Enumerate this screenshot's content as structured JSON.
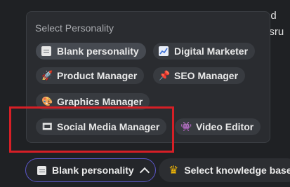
{
  "background_text": {
    "line1": "red",
    "line2": "isru"
  },
  "popup": {
    "title": "Select Personality",
    "options": [
      {
        "label": "Blank personality",
        "icon": "document-icon",
        "selected": true
      },
      {
        "label": "Digital Marketer",
        "icon": "chart-icon"
      },
      {
        "label": "Product Manager",
        "icon": "rocket-icon"
      },
      {
        "label": "SEO Manager",
        "icon": "pushpin-icon"
      },
      {
        "label": "Graphics Manager",
        "icon": "palette-icon"
      },
      {
        "label": "Social Media Manager",
        "icon": "film-icon",
        "highlighted": true
      },
      {
        "label": "Video Editor",
        "icon": "game-controller-icon"
      }
    ]
  },
  "bottom_bar": {
    "personality_label": "Blank personality",
    "knowledge_label": "Select knowledge base"
  },
  "colors": {
    "highlight_box": "#d61f26",
    "accent_border": "#5b56c8",
    "crown": "#f2b705"
  }
}
